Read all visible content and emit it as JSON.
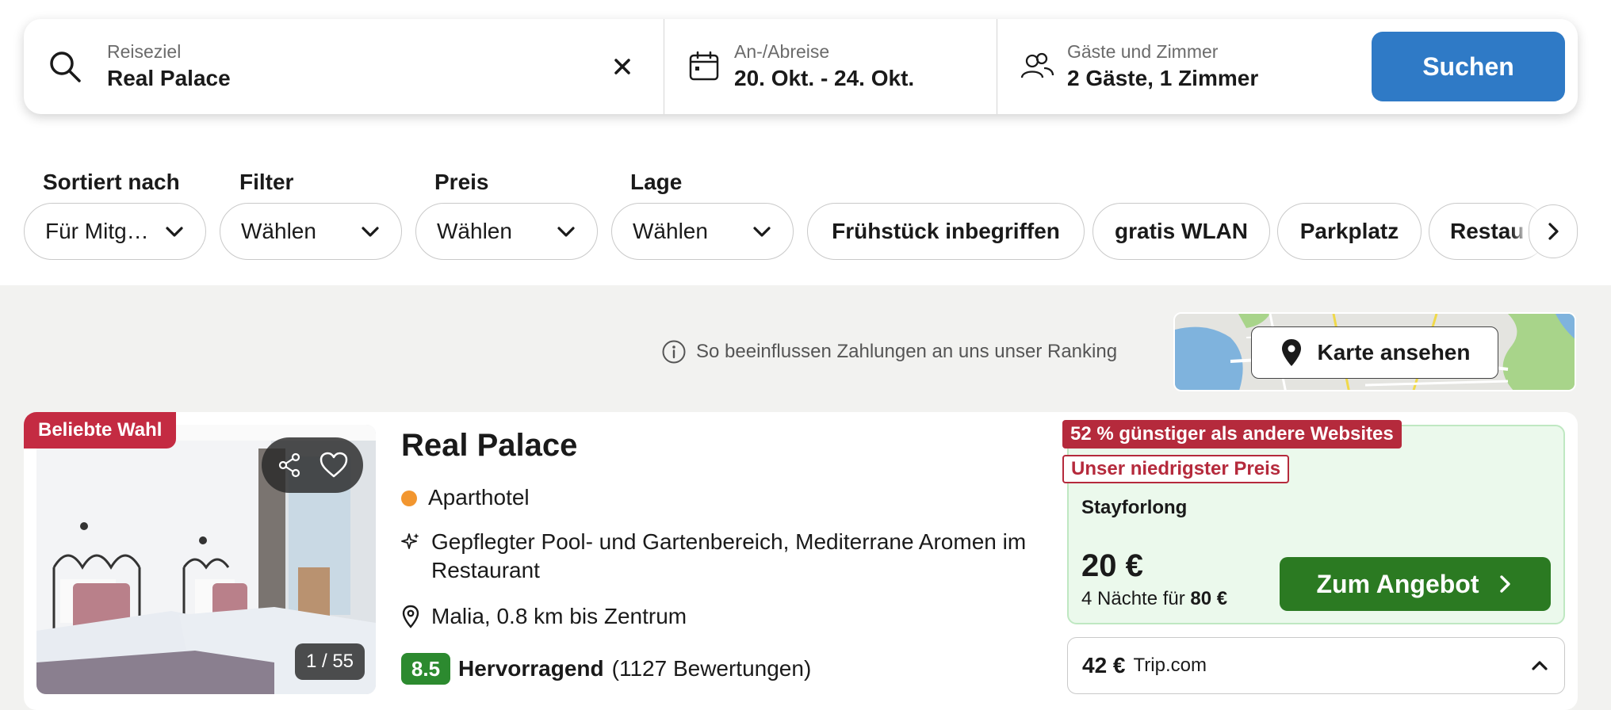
{
  "search": {
    "destination_label": "Reiseziel",
    "destination_value": "Real Palace",
    "dates_label": "An-/Abreise",
    "dates_value": "20. Okt. - 24. Okt.",
    "guests_label": "Gäste und Zimmer",
    "guests_value": "2 Gäste, 1 Zimmer",
    "search_button": "Suchen"
  },
  "filters": {
    "sort_label": "Sortiert nach",
    "sort_value": "Für Mitg…",
    "filter_label": "Filter",
    "filter_value": "Wählen",
    "price_label": "Preis",
    "price_value": "Wählen",
    "location_label": "Lage",
    "location_value": "Wählen",
    "chips": [
      "Frühstück inbegriffen",
      "gratis WLAN",
      "Parkplatz",
      "Restau"
    ]
  },
  "results": {
    "ranking_note": "So beeinflussen Zahlungen an uns unser Ranking",
    "map_button": "Karte ansehen"
  },
  "hotel": {
    "badge": "Beliebte Wahl",
    "photo_count": "1 / 55",
    "name": "Real Palace",
    "type": "Aparthotel",
    "highlights": "Gepflegter Pool- und Gartenbereich, Mediterrane Aromen im",
    "highlights_line2": "Restaurant",
    "location": "Malia, 0.8 km bis Zentrum",
    "rating_score": "8.5",
    "rating_text": "Hervorragend",
    "review_count": "(1127 Bewertungen)"
  },
  "deal": {
    "tag_savings": "52 % günstiger als andere Websites",
    "tag_lowest": "Unser niedrigster Preis",
    "provider": "Stayforlong",
    "price": "20 €",
    "nights_prefix": "4 Nächte für",
    "nights_total": "80 €",
    "offer_button": "Zum Angebot"
  },
  "alt_offer": {
    "price": "42 €",
    "provider": "Trip.com"
  },
  "colors": {
    "search_button": "#2f7ac6",
    "offer_button": "#2b7a22",
    "badge_red": "#c42b42",
    "rating_green": "#2c8a2f",
    "deal_background": "#ebf9ec"
  }
}
